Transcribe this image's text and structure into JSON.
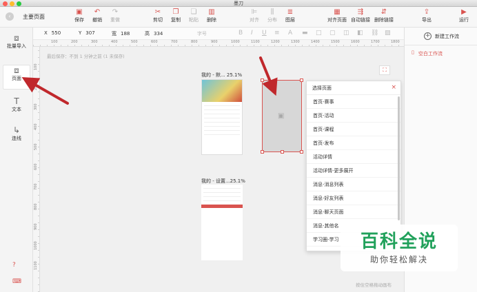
{
  "window": {
    "title": "墨刀"
  },
  "header": {
    "back_icon": "‹",
    "doc_title": "主要页面"
  },
  "toolbar": {
    "save": "保存",
    "undo": "撤销",
    "redo": "重做",
    "cut": "剪切",
    "copy": "复制",
    "paste": "粘贴",
    "delete": "删除",
    "align": "对齐",
    "distribute": "分布",
    "layers": "图层",
    "align_page": "对齐页面",
    "auto_link": "自动链接",
    "remove_link": "删除链接",
    "export": "导出",
    "run": "运行"
  },
  "properties": {
    "x_label": "X",
    "x_value": "550",
    "y_label": "Y",
    "y_value": "307",
    "w_label": "宽",
    "w_value": "188",
    "h_label": "高",
    "h_value": "334",
    "font_placeholder": "字号"
  },
  "sidebar": {
    "items": [
      {
        "label": "批量导入",
        "icon": "image-import-icon"
      },
      {
        "label": "页面",
        "icon": "page-icon"
      },
      {
        "label": "文本",
        "icon": "text-icon"
      },
      {
        "label": "连线",
        "icon": "connector-icon"
      }
    ]
  },
  "ruler": {
    "h": [
      "100",
      "200",
      "300",
      "400",
      "500",
      "600",
      "700",
      "800",
      "900",
      "1000",
      "1100",
      "1200",
      "1300",
      "1400",
      "1500",
      "1600",
      "1700",
      "1800"
    ],
    "v": [
      "100",
      "200",
      "300",
      "400",
      "500",
      "600",
      "700",
      "800",
      "900",
      "1000",
      "1100"
    ]
  },
  "canvas": {
    "autosave": "最后保存：不到 1 分钟之前 (1 未保存)",
    "frame1_label": "我的 - 默...",
    "frame1_zoom": "25.1%",
    "frame2_label": "我的 - 设置...",
    "frame2_zoom": "25.1%",
    "hint": "按住空格拖动画布"
  },
  "popup": {
    "title": "选择页面",
    "close": "×",
    "items": [
      "首页-赛事",
      "首页-活动",
      "首页-课程",
      "首页-发布",
      "活动详情",
      "活动详情-更多展开",
      "消息-消息列表",
      "消息-好友列表",
      "消息-聊天页面",
      "消息-其他名",
      "学习圈-学习"
    ]
  },
  "right_panel": {
    "new_flow": "新建工作流",
    "flows": [
      "空白工作流"
    ]
  },
  "watermark": {
    "logo": "百科全说",
    "sub": "助你轻松解决"
  },
  "colors": {
    "accent": "#d9534f",
    "watermark": "#21a15b"
  }
}
